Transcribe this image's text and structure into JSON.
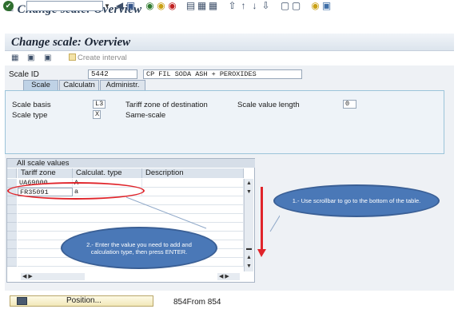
{
  "window": {
    "title": "Change scale: Overview"
  },
  "screen": {
    "title": "Change scale: Overview"
  },
  "app_toolbar": {
    "create_interval_label": "Create interval"
  },
  "header": {
    "scale_id_label": "Scale ID",
    "scale_id_value": "5442",
    "scale_description": "CP FIL SODA ASH + PEROXIDES"
  },
  "tabs": [
    {
      "label": "Scale",
      "active": true
    },
    {
      "label": "Calculatn",
      "active": false
    },
    {
      "label": "Administr.",
      "active": false
    }
  ],
  "scale_tab": {
    "scale_basis_label": "Scale basis",
    "scale_basis_value": "L3",
    "tariff_zone_dest_label": "Tariff zone of destination",
    "scale_value_length_label": "Scale value length",
    "scale_value_length_value": "0",
    "scale_type_label": "Scale type",
    "scale_type_value": "X",
    "scale_type_text": "Same-scale"
  },
  "table": {
    "title": "All scale values",
    "columns": [
      "Tariff zone",
      "Calculat. type",
      "Description"
    ],
    "rows": [
      {
        "tariff_zone": "UA69000",
        "calc_type": "A",
        "description": ""
      },
      {
        "tariff_zone": "FR35091",
        "calc_type": "a",
        "description": ""
      }
    ]
  },
  "annotations": {
    "note1": "1.- Use scrollbar to go to the bottom of the table.",
    "note2": "2.- Enter the value you need to add and calculation type, then press ENTER."
  },
  "footer": {
    "position_button_label": "Position...",
    "entries_text": "854From  854"
  },
  "colors": {
    "annotation_red": "#e0242a",
    "bubble_blue": "#4a78b7"
  }
}
